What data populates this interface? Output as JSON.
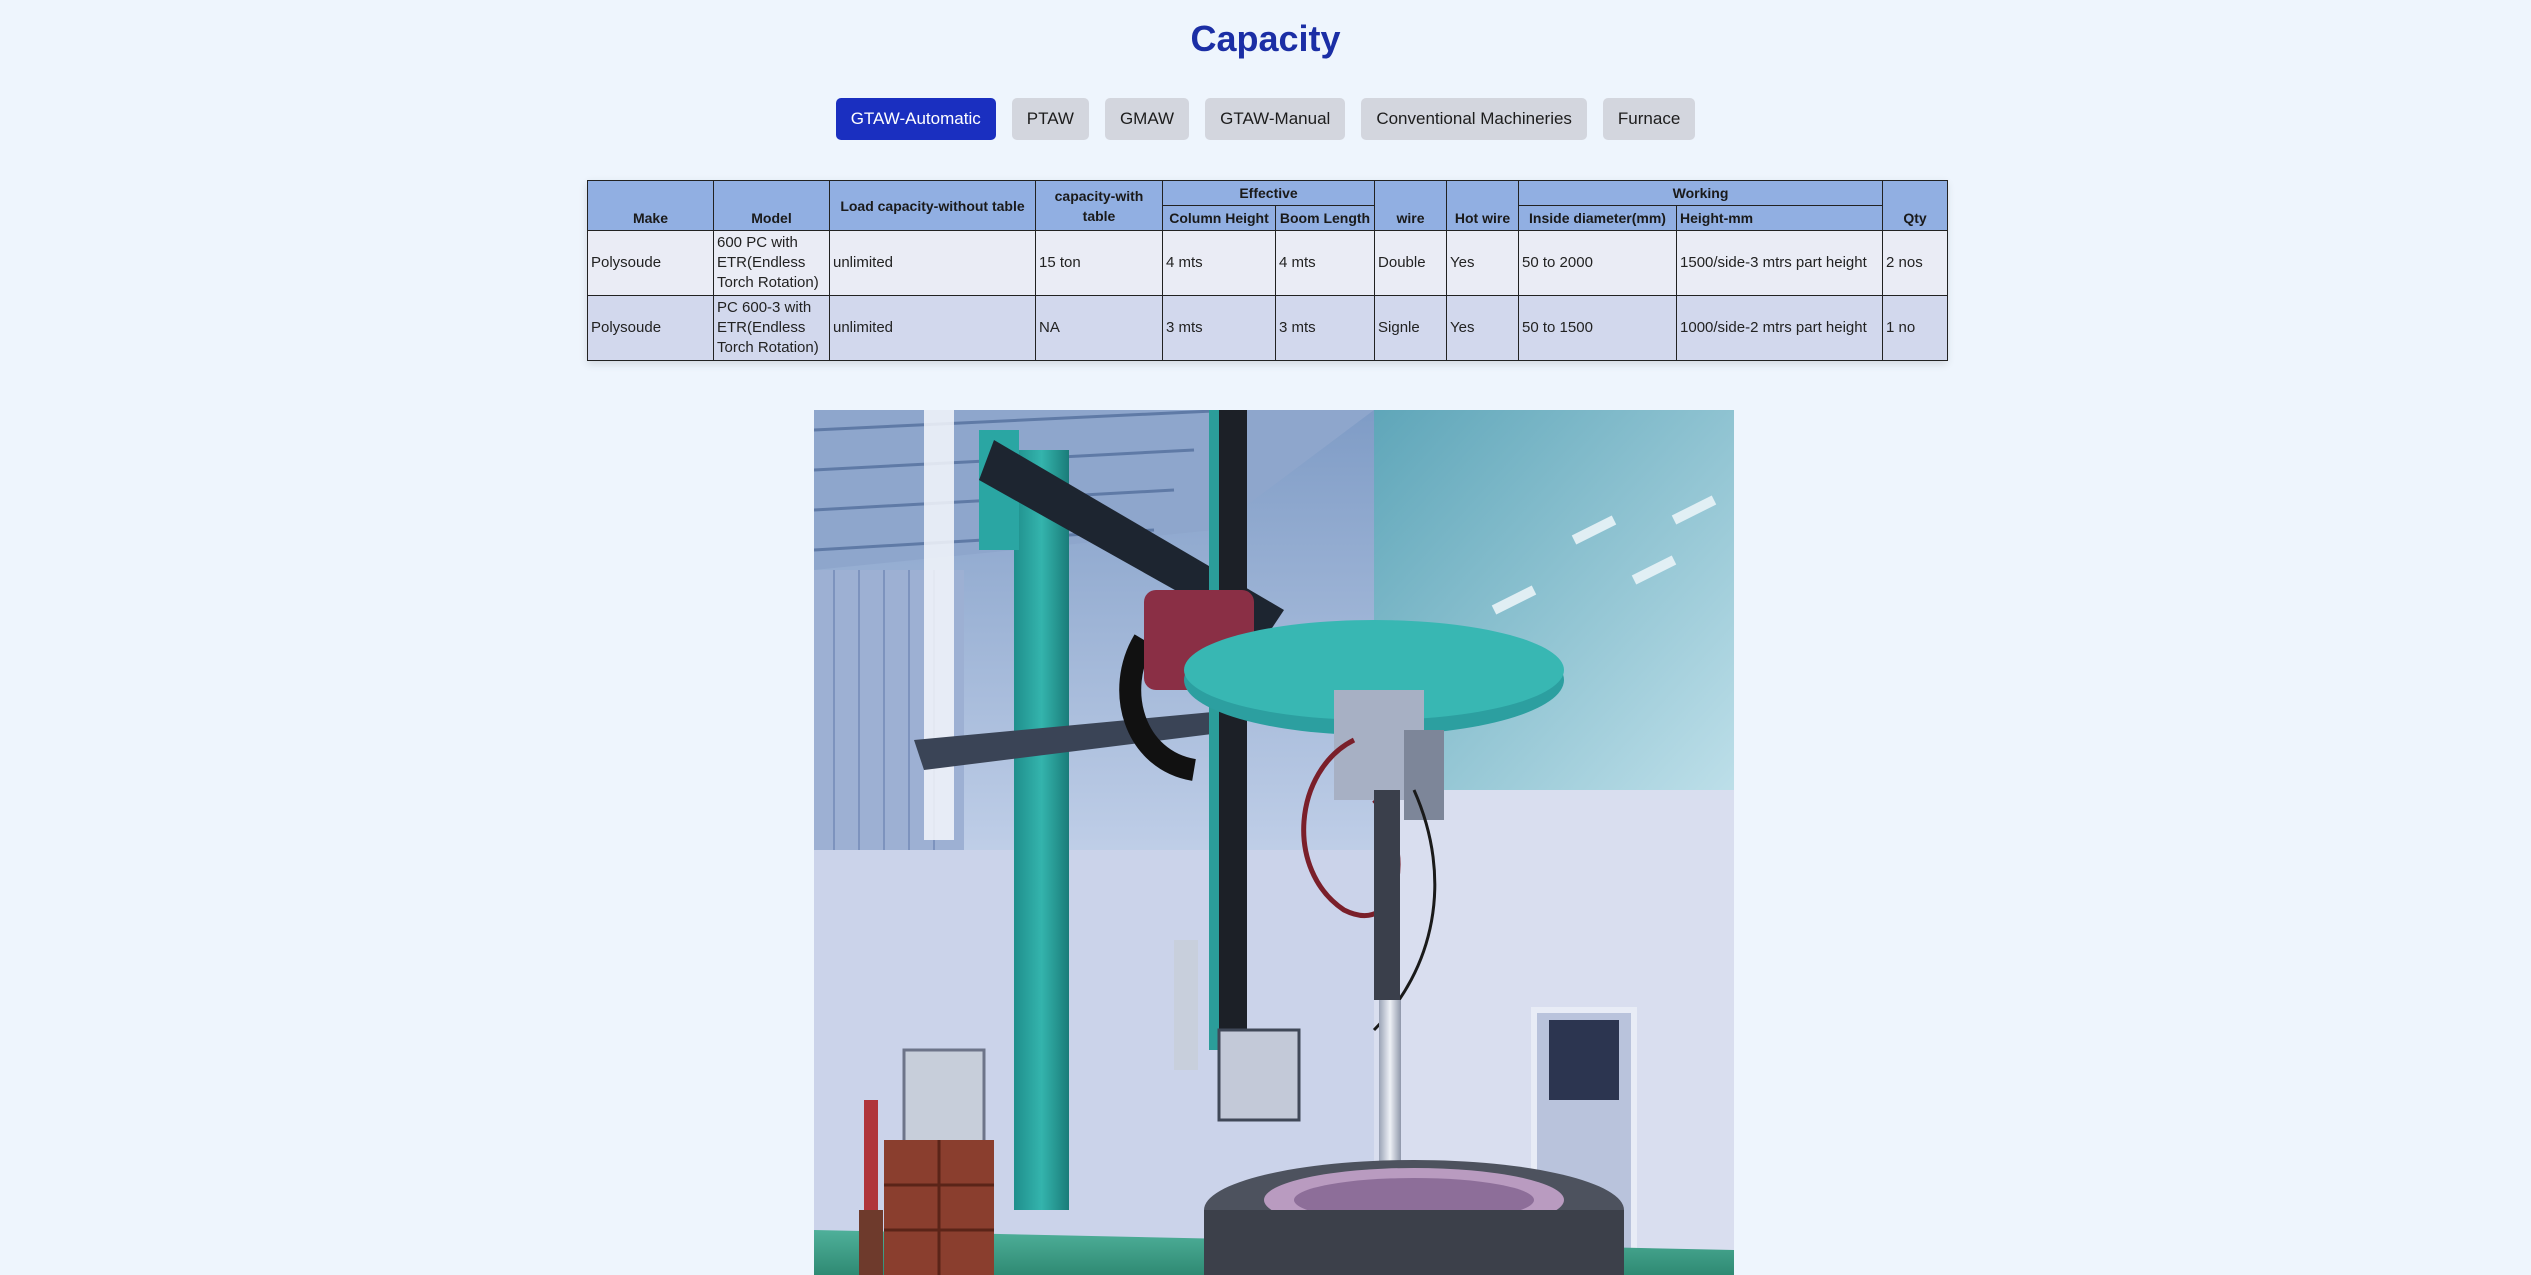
{
  "page": {
    "title": "Capacity"
  },
  "tabs": [
    {
      "label": "GTAW-Automatic",
      "active": true
    },
    {
      "label": "PTAW",
      "active": false
    },
    {
      "label": "GMAW",
      "active": false
    },
    {
      "label": "GTAW-Manual",
      "active": false
    },
    {
      "label": "Conventional Machineries",
      "active": false
    },
    {
      "label": "Furnace",
      "active": false
    }
  ],
  "table": {
    "group_headers": {
      "effective": "Effective",
      "working": "Working"
    },
    "headers": {
      "make": "Make",
      "model": "Model",
      "load_without": "Load capacity-without table",
      "capacity_with": "capacity-with table",
      "column_height": "Column Height",
      "boom_length": "Boom Length",
      "wire": "wire",
      "hot_wire": "Hot wire",
      "inside_diameter": "Inside diameter(mm)",
      "height_mm": "Height-mm",
      "qty": "Qty"
    },
    "rows": [
      {
        "make": "Polysoude",
        "model": "600 PC with ETR(Endless Torch Rotation)",
        "load_without": "unlimited",
        "capacity_with": "15 ton",
        "column_height": "4 mts",
        "boom_length": "4 mts",
        "wire": "Double",
        "hot_wire": "Yes",
        "inside_diameter": "50 to 2000",
        "height_mm": "1500/side-3 mtrs part height",
        "qty": "2 nos"
      },
      {
        "make": "Polysoude",
        "model": "PC 600-3 with ETR(Endless Torch Rotation)",
        "load_without": "unlimited",
        "capacity_with": "NA",
        "column_height": "3 mts",
        "boom_length": "3 mts",
        "wire": "Signle",
        "hot_wire": "Yes",
        "inside_diameter": "50 to 1500",
        "height_mm": "1000/side-2 mtrs part height",
        "qty": "1 no"
      }
    ]
  },
  "colors": {
    "title": "#1b2ea5",
    "tab_active_bg": "#1a2fc0",
    "tab_inactive_bg": "#d3d6de",
    "header_bg": "#91afe2",
    "row_a_bg": "#eaecf5",
    "row_b_bg": "#d2d8ed",
    "page_bg": "#eef5fd"
  },
  "photo": {
    "subject": "welding-column-and-boom-machine-photo"
  }
}
